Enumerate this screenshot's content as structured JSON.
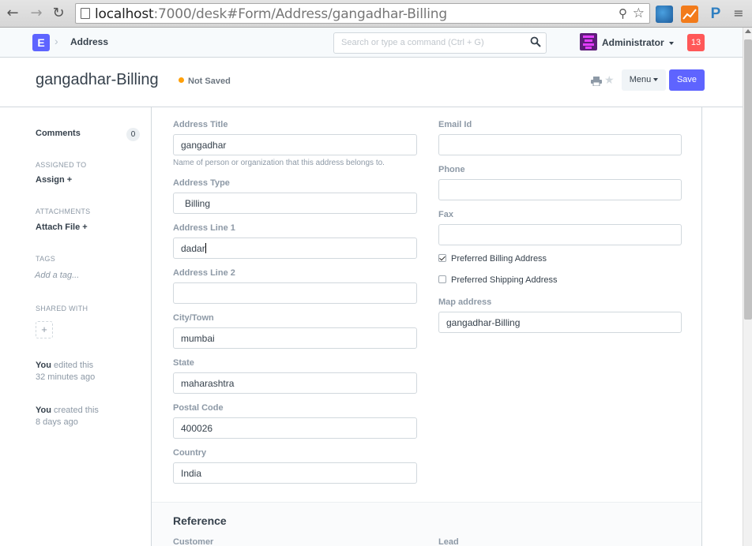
{
  "browser": {
    "url_host": "localhost",
    "url_rest": ":7000/desk#Form/Address/gangadhar-Billing"
  },
  "appbar": {
    "logo": "E",
    "breadcrumb": "Address",
    "search_placeholder": "Search or type a command (Ctrl + G)",
    "user": "Administrator",
    "notifications": "13"
  },
  "page": {
    "title": "gangadhar-Billing",
    "status": "Not Saved",
    "menu_label": "Menu",
    "save_label": "Save"
  },
  "sidebar": {
    "comments_label": "Comments",
    "comments_count": "0",
    "assigned_to_label": "ASSIGNED TO",
    "assign_label": "Assign +",
    "attachments_label": "ATTACHMENTS",
    "attach_label": "Attach File +",
    "tags_label": "TAGS",
    "add_tag": "Add a tag...",
    "shared_with_label": "SHARED WITH",
    "share_plus": "+",
    "activity": [
      {
        "user": "You",
        "action": " edited this",
        "when": "32 minutes ago"
      },
      {
        "user": "You",
        "action": " created this",
        "when": "8 days ago"
      }
    ]
  },
  "form": {
    "left": {
      "address_title": {
        "label": "Address Title",
        "value": "gangadhar",
        "help": "Name of person or organization that this address belongs to."
      },
      "address_type": {
        "label": "Address Type",
        "value": "Billing"
      },
      "address_line1": {
        "label": "Address Line 1",
        "value": "dadar"
      },
      "address_line2": {
        "label": "Address Line 2",
        "value": ""
      },
      "city": {
        "label": "City/Town",
        "value": "mumbai"
      },
      "state": {
        "label": "State",
        "value": "maharashtra"
      },
      "postal_code": {
        "label": "Postal Code",
        "value": "400026"
      },
      "country": {
        "label": "Country",
        "value": "India"
      }
    },
    "right": {
      "email": {
        "label": "Email Id",
        "value": ""
      },
      "phone": {
        "label": "Phone",
        "value": ""
      },
      "fax": {
        "label": "Fax",
        "value": ""
      },
      "preferred_billing": {
        "label": "Preferred Billing Address",
        "checked": true
      },
      "preferred_shipping": {
        "label": "Preferred Shipping Address",
        "checked": false
      },
      "map_address": {
        "label": "Map address",
        "value": "gangadhar-Billing"
      }
    },
    "reference": {
      "title": "Reference",
      "customer_label": "Customer",
      "lead_label": "Lead"
    }
  },
  "colors": {
    "accent": "#5e64ff",
    "notif": "#ff5858",
    "status_dot": "#ffa00a"
  }
}
